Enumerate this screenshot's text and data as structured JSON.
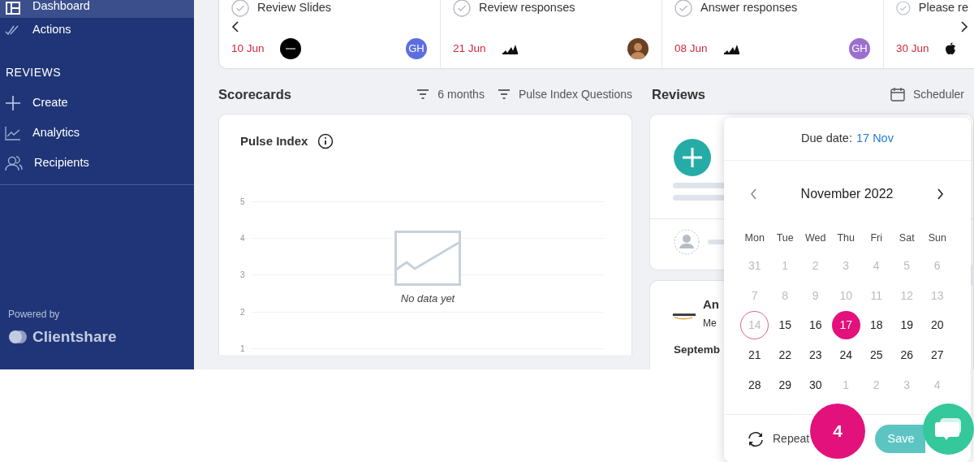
{
  "sidebar": {
    "items": [
      {
        "label": "Dashboard",
        "selected": true
      },
      {
        "label": "Actions",
        "selected": false
      }
    ],
    "section": "REVIEWS",
    "section_items": [
      {
        "label": "Create",
        "selected": false
      },
      {
        "label": "Analytics",
        "selected": false
      },
      {
        "label": "Recipients",
        "selected": false
      }
    ],
    "powered_by": "Powered by",
    "brand": "Clientshare"
  },
  "actions": [
    {
      "title": "Review Slides",
      "date": "10 Jun",
      "logo": {
        "kind": "round"
      },
      "avatar": {
        "kind": "initials",
        "text": "GH",
        "color": "#5b6ee0"
      }
    },
    {
      "title": "Review responses",
      "date": "21 Jun",
      "logo": {
        "kind": "stripes"
      },
      "avatar": {
        "kind": "photo"
      }
    },
    {
      "title": "Answer responses",
      "date": "08 Jun",
      "logo": {
        "kind": "stripes"
      },
      "avatar": {
        "kind": "initials",
        "text": "GH",
        "color": "#9b6fd0"
      }
    },
    {
      "title": "Please re",
      "date": "30 Jun",
      "logo": {
        "kind": "fruit"
      }
    }
  ],
  "scorecards": {
    "title": "Scorecards",
    "filters": [
      "6 months",
      "Pulse Index Questions"
    ],
    "card": {
      "title": "Pulse Index",
      "y_labels": [
        "5",
        "4",
        "3",
        "2",
        "1"
      ],
      "empty_message": "No data yet"
    }
  },
  "reviews": {
    "title": "Reviews",
    "scheduler": "Scheduler",
    "review_card": {
      "company": "An",
      "subtitle": "Me",
      "period": "Septemb"
    }
  },
  "scheduler_popup": {
    "due_label": "Due date:",
    "due_value": "17 Nov",
    "month": "November 2022",
    "weekdays": [
      "Mon",
      "Tue",
      "Wed",
      "Thu",
      "Fri",
      "Sat",
      "Sun"
    ],
    "weeks": [
      [
        {
          "label": "31",
          "muted": true,
          "selected": false,
          "today": false
        },
        {
          "label": "1",
          "muted": true,
          "selected": false,
          "today": false
        },
        {
          "label": "2",
          "muted": true,
          "selected": false,
          "today": false
        },
        {
          "label": "3",
          "muted": true,
          "selected": false,
          "today": false
        },
        {
          "label": "4",
          "muted": true,
          "selected": false,
          "today": false
        },
        {
          "label": "5",
          "muted": true,
          "selected": false,
          "today": false
        },
        {
          "label": "6",
          "muted": true,
          "selected": false,
          "today": false
        }
      ],
      [
        {
          "label": "7",
          "muted": true,
          "selected": false,
          "today": false
        },
        {
          "label": "8",
          "muted": true,
          "selected": false,
          "today": false
        },
        {
          "label": "9",
          "muted": true,
          "selected": false,
          "today": false
        },
        {
          "label": "10",
          "muted": true,
          "selected": false,
          "today": false
        },
        {
          "label": "11",
          "muted": true,
          "selected": false,
          "today": false
        },
        {
          "label": "12",
          "muted": true,
          "selected": false,
          "today": false
        },
        {
          "label": "13",
          "muted": true,
          "selected": false,
          "today": false
        }
      ],
      [
        {
          "label": "14",
          "muted": true,
          "selected": false,
          "today": true
        },
        {
          "label": "15",
          "muted": false,
          "selected": false,
          "today": false
        },
        {
          "label": "16",
          "muted": false,
          "selected": false,
          "today": false
        },
        {
          "label": "17",
          "muted": false,
          "selected": true,
          "today": false
        },
        {
          "label": "18",
          "muted": false,
          "selected": false,
          "today": false
        },
        {
          "label": "19",
          "muted": false,
          "selected": false,
          "today": false
        },
        {
          "label": "20",
          "muted": false,
          "selected": false,
          "today": false
        }
      ],
      [
        {
          "label": "21",
          "muted": false,
          "selected": false,
          "today": false
        },
        {
          "label": "22",
          "muted": false,
          "selected": false,
          "today": false
        },
        {
          "label": "23",
          "muted": false,
          "selected": false,
          "today": false
        },
        {
          "label": "24",
          "muted": false,
          "selected": false,
          "today": false
        },
        {
          "label": "25",
          "muted": false,
          "selected": false,
          "today": false
        },
        {
          "label": "26",
          "muted": false,
          "selected": false,
          "today": false
        },
        {
          "label": "27",
          "muted": false,
          "selected": false,
          "today": false
        }
      ],
      [
        {
          "label": "28",
          "muted": false,
          "selected": false,
          "today": false
        },
        {
          "label": "29",
          "muted": false,
          "selected": false,
          "today": false
        },
        {
          "label": "30",
          "muted": false,
          "selected": false,
          "today": false
        },
        {
          "label": "1",
          "muted": true,
          "selected": false,
          "today": false
        },
        {
          "label": "2",
          "muted": true,
          "selected": false,
          "today": false
        },
        {
          "label": "3",
          "muted": true,
          "selected": false,
          "today": false
        },
        {
          "label": "4",
          "muted": true,
          "selected": false,
          "today": false
        }
      ]
    ],
    "repeat": "Repeat",
    "save": "Save"
  },
  "tour_badge": "4"
}
